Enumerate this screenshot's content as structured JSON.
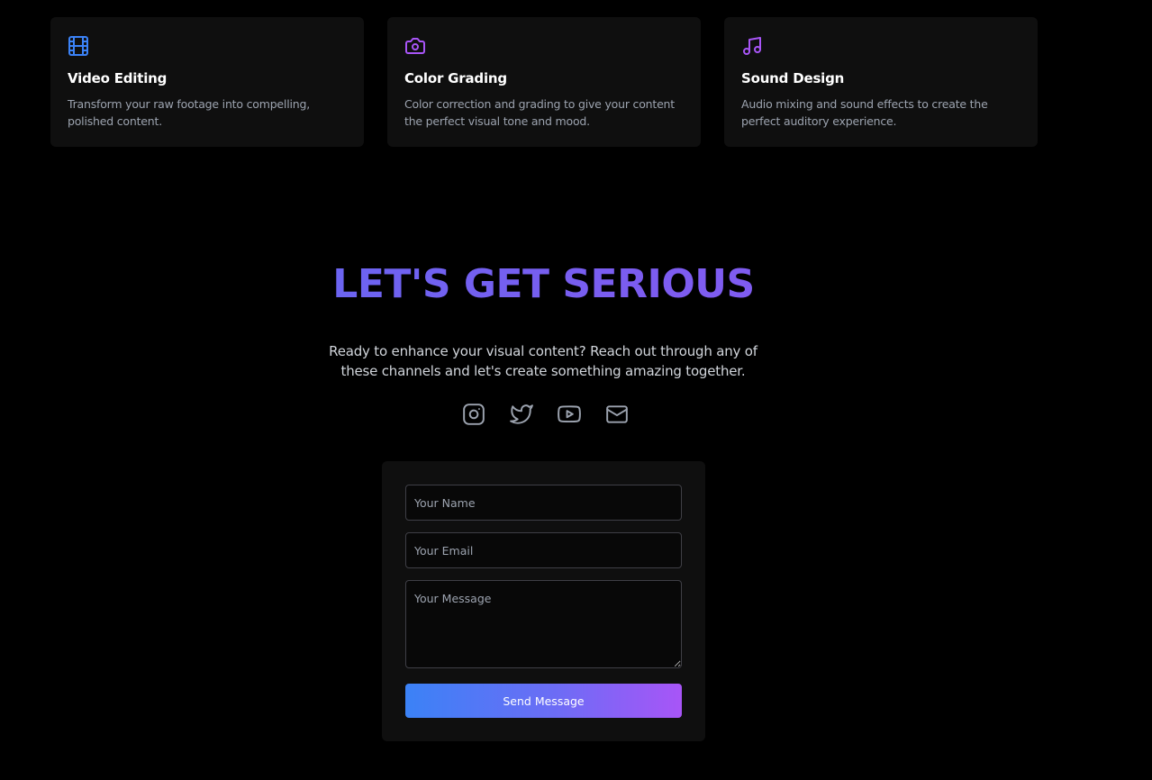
{
  "services": [
    {
      "icon": "film-icon",
      "title": "Video Editing",
      "description": "Transform your raw footage into compelling, polished content."
    },
    {
      "icon": "camera-icon",
      "title": "Color Grading",
      "description": "Color correction and grading to give your content the perfect visual tone and mood."
    },
    {
      "icon": "music-icon",
      "title": "Sound Design",
      "description": "Audio mixing and sound effects to create the perfect auditory experience."
    }
  ],
  "contact": {
    "title": "LET'S GET SERIOUS",
    "subtitle": "Ready to enhance your visual content? Reach out through any of these channels and let's create something amazing together.",
    "socials": [
      "instagram-icon",
      "twitter-icon",
      "youtube-icon",
      "mail-icon"
    ]
  },
  "form": {
    "name_placeholder": "Your Name",
    "email_placeholder": "Your Email",
    "message_placeholder": "Your Message",
    "submit_label": "Send Message"
  },
  "colors": {
    "background": "#000000",
    "card": "#0f0f0f",
    "accent_blue": "#3b82f6",
    "accent_purple": "#a855f7",
    "muted_text": "#9ca3af"
  }
}
